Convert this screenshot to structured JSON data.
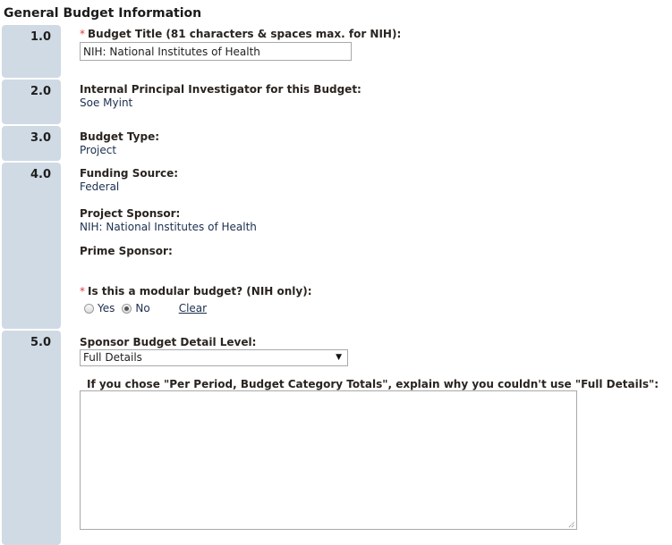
{
  "section_title": "General Budget Information",
  "sections": [
    {
      "number": "1.0"
    },
    {
      "number": "2.0"
    },
    {
      "number": "3.0"
    },
    {
      "number": "4.0"
    },
    {
      "number": "5.0"
    }
  ],
  "budget_title": {
    "required_mark": "*",
    "label": "Budget Title (81 characters & spaces max. for NIH):",
    "value": "NIH: National Institutes of Health"
  },
  "principal_investigator": {
    "label": "Internal Principal Investigator for this Budget:",
    "value": "Soe Myint"
  },
  "budget_type": {
    "label": "Budget Type:",
    "value": "Project"
  },
  "funding_source": {
    "label": "Funding Source:",
    "value": "Federal"
  },
  "project_sponsor": {
    "label": "Project Sponsor:",
    "value": "NIH: National Institutes of Health"
  },
  "prime_sponsor": {
    "label": "Prime Sponsor:",
    "value": ""
  },
  "modular_budget": {
    "required_mark": "*",
    "label": "Is this a modular budget? (NIH only):",
    "options": [
      {
        "label": "Yes",
        "checked": false
      },
      {
        "label": "No",
        "checked": true
      }
    ],
    "clear_label": "Clear"
  },
  "detail_level": {
    "label": "Sponsor Budget Detail Level:",
    "selected": "Full Details",
    "explain_label": "If you chose \"Per Period, Budget Category Totals\", explain why you couldn't use \"Full Details\":",
    "explain_value": ""
  }
}
